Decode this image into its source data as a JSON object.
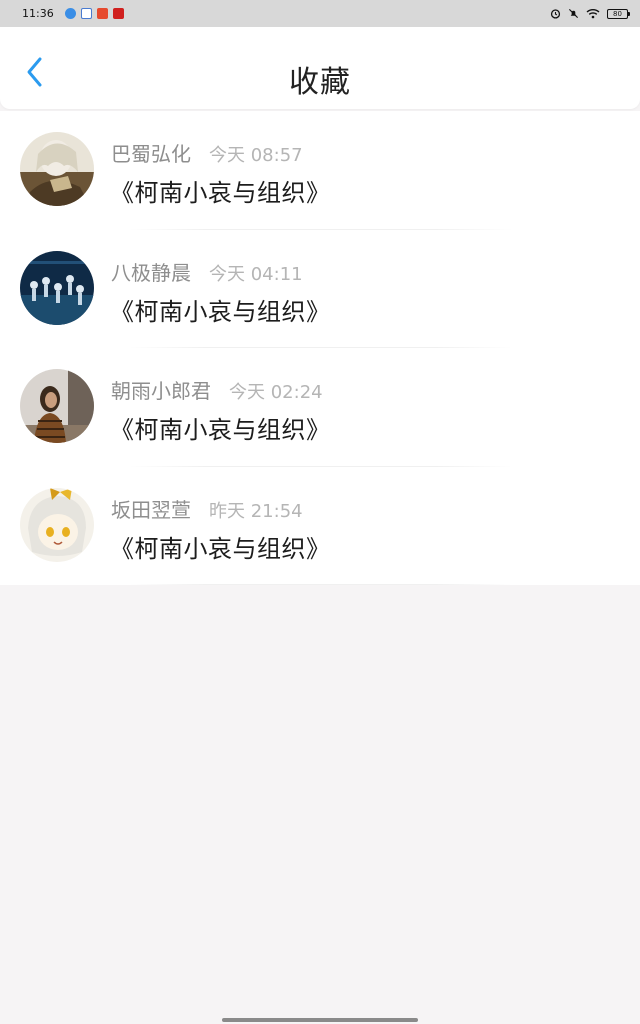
{
  "status_bar": {
    "time": "11:36",
    "battery": "80",
    "icons": [
      "alarm-icon",
      "mute-icon",
      "wifi-icon",
      "battery-icon"
    ]
  },
  "header": {
    "title": "收藏",
    "back_icon": "chevron-left-icon",
    "accent": "#2b9bef"
  },
  "favorites": [
    {
      "user": "巴蜀弘化",
      "time": "今天 08:57",
      "title": "《柯南小哀与组织》"
    },
    {
      "user": "八极静晨",
      "time": "今天 04:11",
      "title": "《柯南小哀与组织》"
    },
    {
      "user": "朝雨小郎君",
      "time": "今天 02:24",
      "title": "《柯南小哀与组织》"
    },
    {
      "user": "坂田翌萱",
      "time": "昨天 21:54",
      "title": "《柯南小哀与组织》"
    }
  ]
}
